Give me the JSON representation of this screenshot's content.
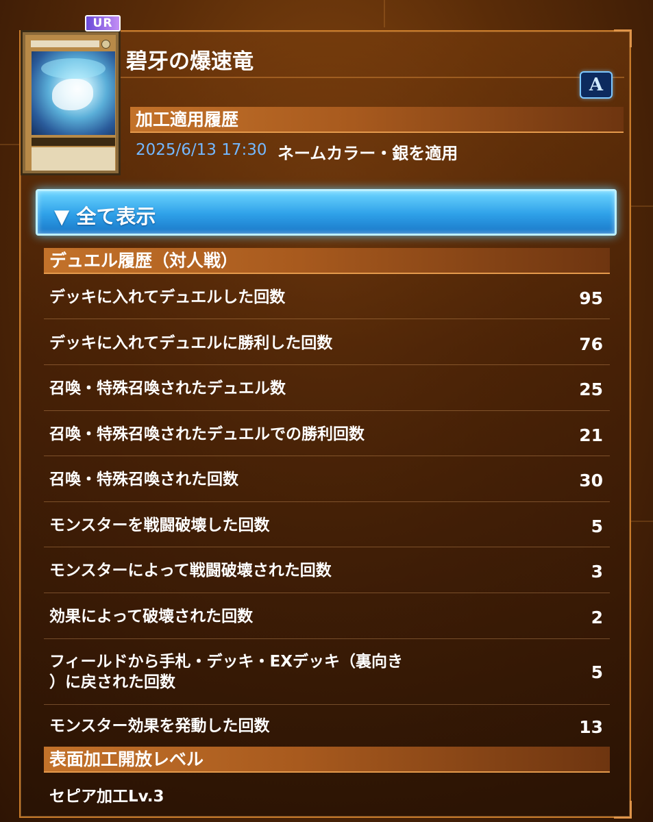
{
  "card": {
    "rarity": "UR",
    "name": "碧牙の爆速竜",
    "rank_badge": "A"
  },
  "processing_history": {
    "header": "加工適用履歴",
    "entries": [
      {
        "date": "2025/6/13 17:30",
        "text": "ネームカラー・銀を適用"
      }
    ]
  },
  "show_all_button": {
    "label": "▼ 全て表示"
  },
  "duel_history": {
    "header": "デュエル履歴（対人戦）",
    "rows": [
      {
        "label": "デッキに入れてデュエルした回数",
        "value": "95"
      },
      {
        "label": "デッキに入れてデュエルに勝利した回数",
        "value": "76"
      },
      {
        "label": "召喚・特殊召喚されたデュエル数",
        "value": "25"
      },
      {
        "label": "召喚・特殊召喚されたデュエルでの勝利回数",
        "value": "21"
      },
      {
        "label": "召喚・特殊召喚された回数",
        "value": "30"
      },
      {
        "label": "モンスターを戦闘破壊した回数",
        "value": "5"
      },
      {
        "label": "モンスターによって戦闘破壊された回数",
        "value": "3"
      },
      {
        "label": "効果によって破壊された回数",
        "value": "2"
      },
      {
        "label_line1": "フィールドから手札・デッキ・EXデッキ（裏向き",
        "label_line2": "）に戻された回数",
        "value": "5"
      },
      {
        "label": "モンスター効果を発動した回数",
        "value": "13"
      }
    ]
  },
  "surface_level": {
    "header": "表面加工開放レベル",
    "value": "セピア加工Lv.3"
  },
  "colors": {
    "accent_orange": "#c3722a",
    "button_blue": "#2ea0e8",
    "date_blue": "#74b8ff",
    "rarity_purple": "#8a6ae8"
  }
}
